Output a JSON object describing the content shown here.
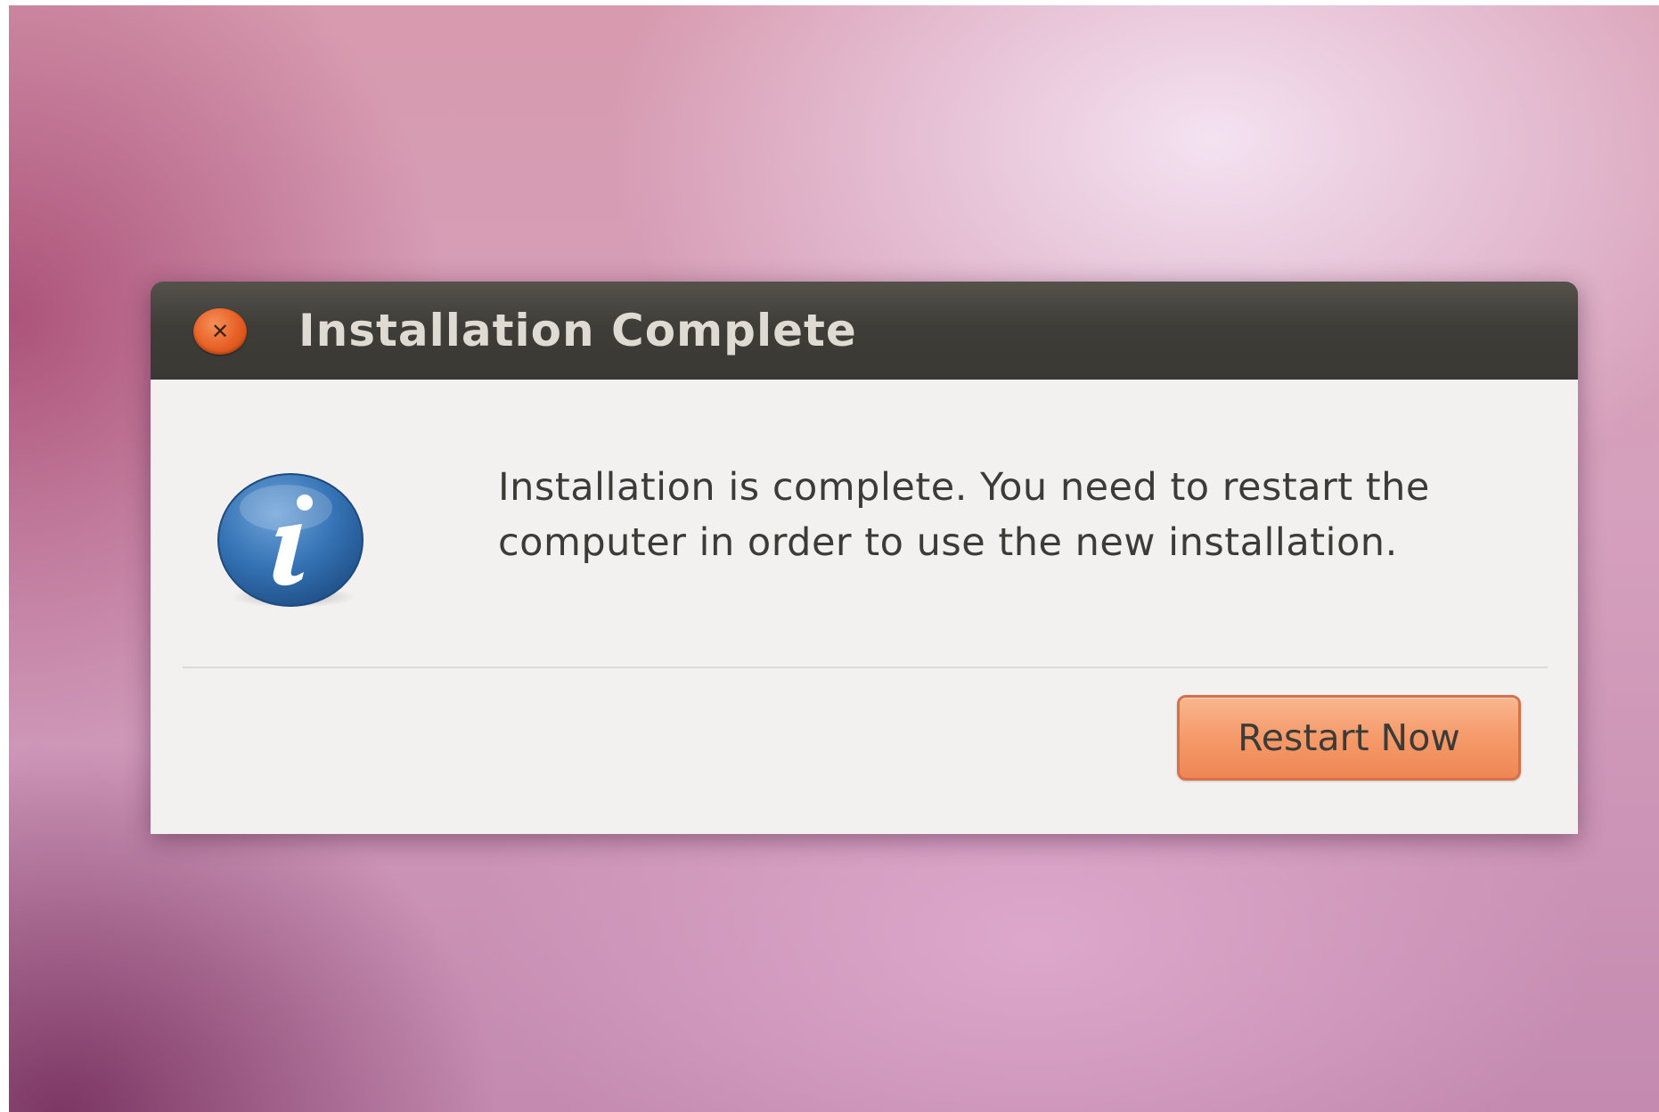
{
  "window": {
    "title": "Installation Complete",
    "close_icon": "close-icon"
  },
  "dialog": {
    "icon": "info-icon",
    "message": "Installation is complete. You need to restart the computer in order to use the new installation.",
    "restart_label": "Restart Now"
  },
  "colors": {
    "titlebar": "#3f3d38",
    "close_button": "#e75f23",
    "accent_button": "#f59a6a",
    "body": "#f2f1ef",
    "info_icon": "#2e6aa8"
  }
}
